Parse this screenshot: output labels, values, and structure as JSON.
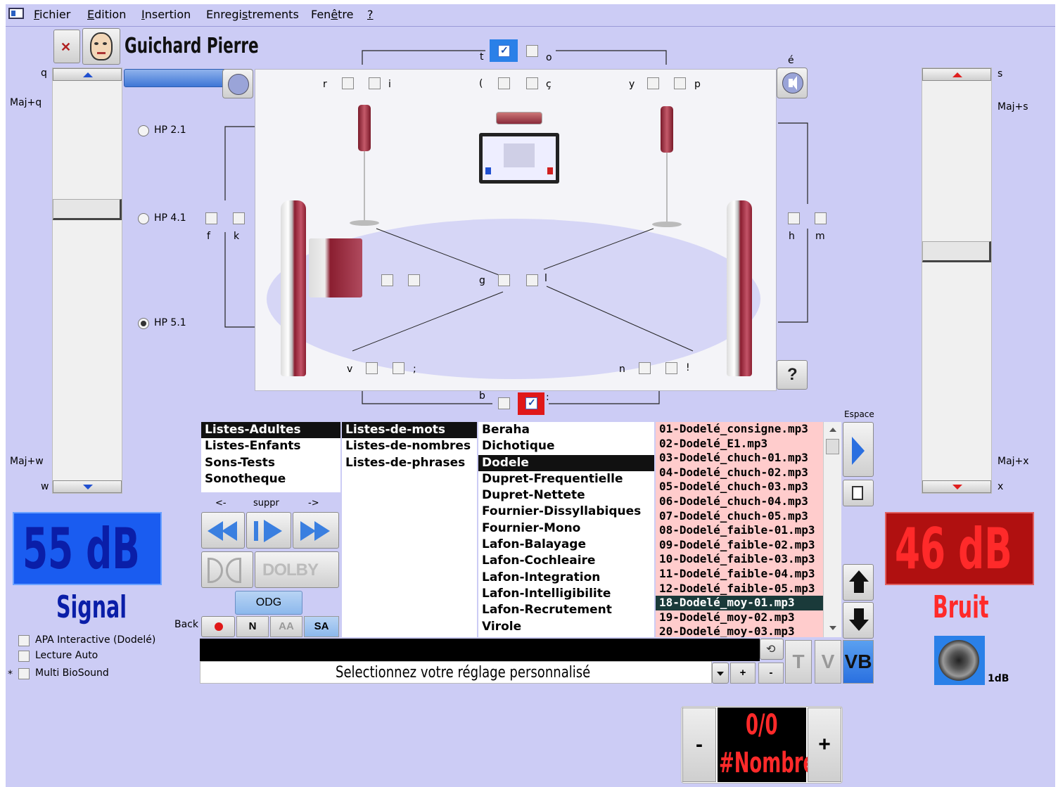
{
  "menu": {
    "items": [
      {
        "u": "F",
        "rest": "ichier"
      },
      {
        "u": "E",
        "rest": "dition"
      },
      {
        "u": "I",
        "rest": "nsertion"
      },
      {
        "u": "",
        "pre": "Enregi",
        "ul": "s",
        "rest": "trements"
      },
      {
        "u": "",
        "pre": "Fen",
        "ul": "ê",
        "rest": "tre"
      },
      {
        "u": "?",
        "rest": ""
      }
    ]
  },
  "patient": {
    "name": "Guichard Pierre"
  },
  "left_slider": {
    "top_key": "q",
    "top_shortcut": "Maj+q",
    "bottom_shortcut": "Maj+w",
    "bottom_key": "w"
  },
  "right_slider": {
    "top_key": "s",
    "top_shortcut": "Maj+s",
    "bottom_shortcut": "Maj+x",
    "bottom_key": "x"
  },
  "hp_modes": [
    {
      "label": "HP 2.1",
      "checked": false
    },
    {
      "label": "HP 4.1",
      "checked": false
    },
    {
      "label": "HP 5.1",
      "checked": true
    }
  ],
  "channel_labels": {
    "t": "t",
    "o": "o",
    "e_acute": "é",
    "r": "r",
    "i": "i",
    "paren": "(",
    "c_cedil": "ç",
    "y": "y",
    "p": "p",
    "f": "f",
    "k": "k",
    "h": "h",
    "m": "m",
    "g": "g",
    "l": "l",
    "v": "v",
    "semi": ";",
    "n": "n",
    "excl": "!",
    "b": "b",
    "colon": ":"
  },
  "lists": {
    "col1": [
      "Listes-Adultes",
      "Listes-Enfants",
      "Sons-Tests",
      "Sonotheque"
    ],
    "col2": [
      "Listes-de-mots",
      "Listes-de-nombres",
      "Listes-de-phrases"
    ],
    "col3": [
      "Beraha",
      "Dichotique",
      "Dodele",
      "Dupret-Frequentielle",
      "Dupret-Nettete",
      "Fournier-Dissyllabiques",
      "Fournier-Mono",
      "Lafon-Balayage",
      "Lafon-Cochleaire",
      "Lafon-Integration",
      "Lafon-Intelligibilite",
      "Lafon-Recrutement",
      "Virole"
    ],
    "files": [
      "01-Dodelé_consigne.mp3",
      "02-Dodelé_E1.mp3",
      "03-Dodelé_chuch-01.mp3",
      "04-Dodelé_chuch-02.mp3",
      "05-Dodelé_chuch-03.mp3",
      "06-Dodelé_chuch-04.mp3",
      "07-Dodelé_chuch-05.mp3",
      "08-Dodelé_faible-01.mp3",
      "09-Dodelé_faible-02.mp3",
      "10-Dodelé_faible-03.mp3",
      "11-Dodelé_faible-04.mp3",
      "12-Dodelé_faible-05.mp3",
      "18-Dodelé_moy-01.mp3",
      "19-Dodelé_moy-02.mp3",
      "20-Dodelé_moy-03.mp3"
    ]
  },
  "transport": {
    "prev": "<-",
    "suppr": "suppr",
    "next": "->",
    "odg": "ODG",
    "dolby": "DOLBY",
    "back": "Back",
    "n": "N",
    "aa": "AA",
    "sa": "SA"
  },
  "signal": {
    "level": "55 dB",
    "label": "Signal"
  },
  "noise": {
    "level": "46 dB",
    "label": "Bruit",
    "step": "1dB"
  },
  "options": [
    "APA Interactive (Dodelé)",
    "Lecture Auto",
    "Multi BioSound"
  ],
  "multi_marker": "*",
  "espace_label": "Espace",
  "preset": {
    "text": "Selectionnez votre réglage personnalisé",
    "plus": "+",
    "minus": "-"
  },
  "tv_buttons": {
    "t": "T",
    "v": "V",
    "vb": "VB"
  },
  "counter": {
    "value": "0/0",
    "label": "#Nombre",
    "minus": "-",
    "plus": "+"
  },
  "colors": {
    "signal_lcd": "#1a5cf0",
    "signal_text": "#0a1ea8",
    "noise_lcd": "#b01010",
    "noise_text": "#ff2a2a",
    "bg": "#ccccf5",
    "file_bg": "#ffcccc"
  }
}
